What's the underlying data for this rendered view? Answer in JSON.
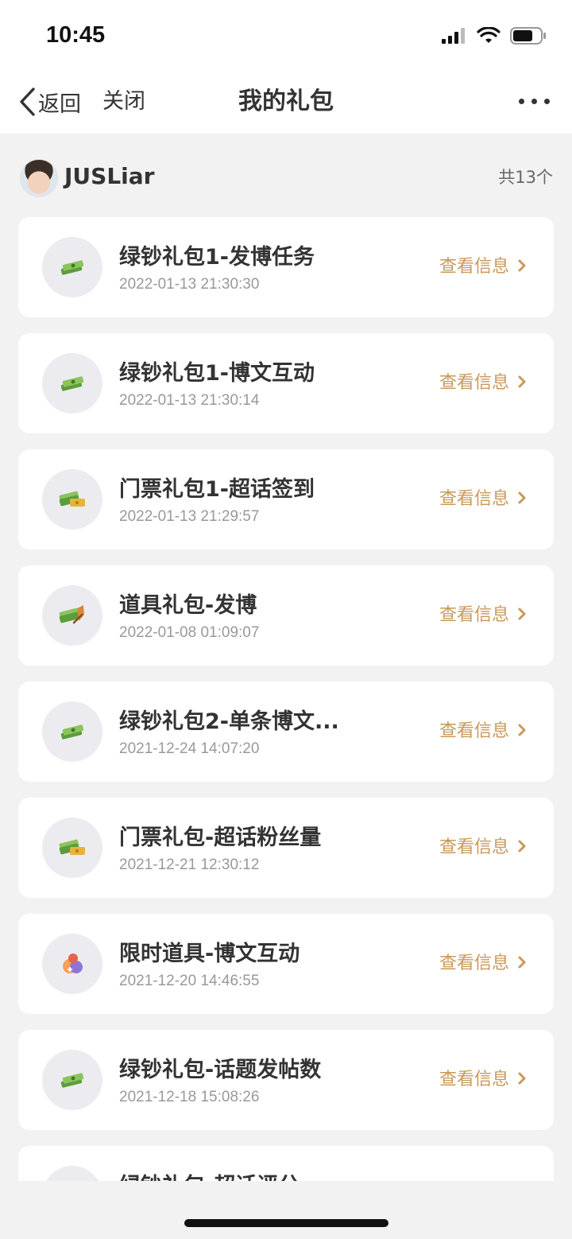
{
  "status_bar": {
    "time": "10:45"
  },
  "nav": {
    "back_label": "返回",
    "close_label": "关闭",
    "title": "我的礼包"
  },
  "user": {
    "name": "JUSLiar",
    "total": "共13个"
  },
  "items": [
    {
      "title": "绿钞礼包1-发博任务",
      "date": "2022-01-13 21:30:30",
      "action": "查看信息",
      "icon": "green-cash-icon"
    },
    {
      "title": "绿钞礼包1-博文互动",
      "date": "2022-01-13 21:30:14",
      "action": "查看信息",
      "icon": "green-cash-icon"
    },
    {
      "title": "门票礼包1-超话签到",
      "date": "2022-01-13 21:29:57",
      "action": "查看信息",
      "icon": "ticket-cash-icon"
    },
    {
      "title": "道具礼包-发博",
      "date": "2022-01-08 01:09:07",
      "action": "查看信息",
      "icon": "prop-cash-icon"
    },
    {
      "title": "绿钞礼包2-单条博文...",
      "date": "2021-12-24 14:07:20",
      "action": "查看信息",
      "icon": "green-cash-icon"
    },
    {
      "title": "门票礼包-超话粉丝量",
      "date": "2021-12-21 12:30:12",
      "action": "查看信息",
      "icon": "ticket-cash-icon"
    },
    {
      "title": "限时道具-博文互动",
      "date": "2021-12-20 14:46:55",
      "action": "查看信息",
      "icon": "limited-prop-icon"
    },
    {
      "title": "绿钞礼包-话题发帖数",
      "date": "2021-12-18 15:08:26",
      "action": "查看信息",
      "icon": "green-cash-icon"
    },
    {
      "title": "绿钞礼包-超话评分",
      "date": "",
      "action": "",
      "icon": "green-cash-icon"
    }
  ],
  "colors": {
    "accent": "#c8995a",
    "background": "#f2f2f2",
    "card": "#ffffff",
    "icon_bg": "#ececf0"
  }
}
